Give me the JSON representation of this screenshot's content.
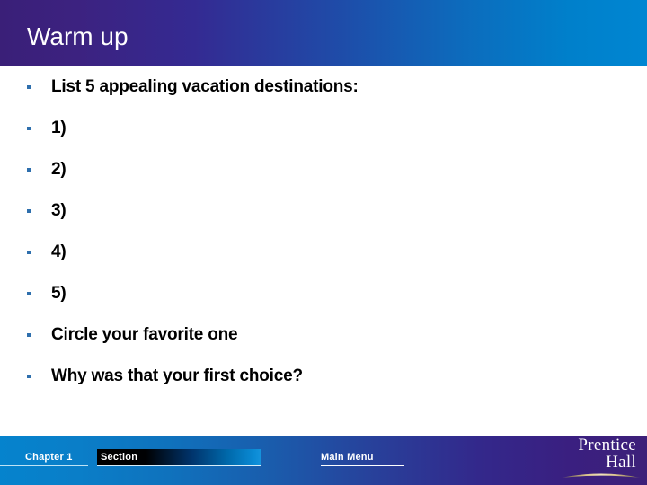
{
  "slide": {
    "title": "Warm up",
    "bullets": [
      {
        "text": "List 5 appealing vacation destinations:"
      },
      {
        "text": "1)"
      },
      {
        "text": "2)"
      },
      {
        "text": "3)"
      },
      {
        "text": "4)"
      },
      {
        "text": "5)"
      },
      {
        "text": "Circle your favorite one"
      },
      {
        "text": "Why was that your first choice?"
      }
    ]
  },
  "footer": {
    "chapter_label": "Chapter 1",
    "section_label": "Section",
    "main_menu_label": "Main Menu",
    "logo_line1": "Prentice",
    "logo_line2": "Hall"
  },
  "colors": {
    "header_left": "#3a1f78",
    "header_right": "#0086d2",
    "footer_left": "#0583cd",
    "footer_right": "#3d2079",
    "bullet_dot": "#2e6fad",
    "body_text": "#000000",
    "title_text": "#ffffff",
    "logo_arc": "#d8c089"
  }
}
